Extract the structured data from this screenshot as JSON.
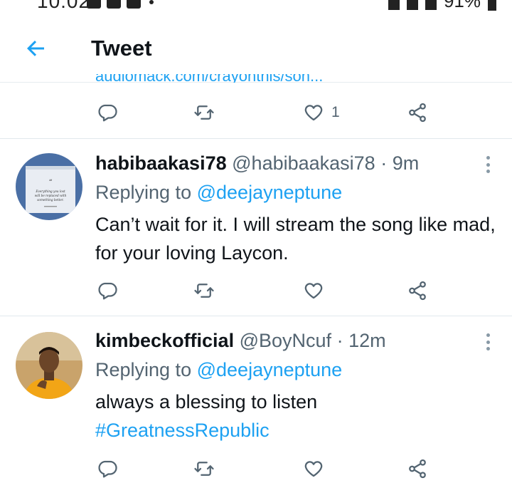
{
  "status_bar": {
    "time": "10:02",
    "battery": "91%"
  },
  "header": {
    "title": "Tweet",
    "back_icon": "arrow-left-icon"
  },
  "previous_tweet": {
    "clipped_text": "audiomack.com/crayonthis/son...",
    "like_count": "1"
  },
  "tweets": [
    {
      "display_name": "habibaakasi78",
      "handle": "@habibaakasi78",
      "separator": "·",
      "time": "9m",
      "replying_label": "Replying to",
      "replying_handle": "@deejayneptune",
      "text": "Can’t wait for it. I will stream the song like mad, for your loving Laycon.",
      "avatar_quote": "Everything you lost will be replaced with something better."
    },
    {
      "display_name": "kimbeckofficial",
      "handle": "@BoyNcuf",
      "separator": "·",
      "time": "12m",
      "replying_label": "Replying to",
      "replying_handle": "@deejayneptune",
      "text": "always a blessing to listen",
      "hashtag": "#GreatnessRepublic"
    }
  ],
  "icons": [
    "reply-icon",
    "retweet-icon",
    "like-icon",
    "share-icon",
    "more-icon"
  ],
  "colors": {
    "accent": "#1da1f2",
    "secondary_text": "#536471",
    "divider": "#e1e8ed"
  }
}
